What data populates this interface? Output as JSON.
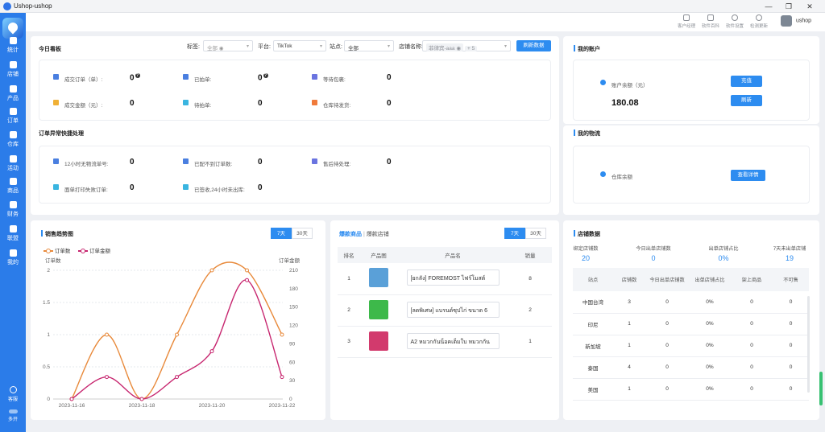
{
  "app": {
    "title": "Ushop-ushop"
  },
  "window": {
    "minimize": "—",
    "restore": "❐",
    "close": "✕"
  },
  "sidebar": {
    "items": [
      {
        "label": "统计",
        "icon": "bar-chart-icon"
      },
      {
        "label": "店铺",
        "icon": "store-icon"
      },
      {
        "label": "产品",
        "icon": "product-icon"
      },
      {
        "label": "订单",
        "icon": "order-icon"
      },
      {
        "label": "仓库",
        "icon": "warehouse-icon"
      },
      {
        "label": "活动",
        "icon": "gift-icon"
      },
      {
        "label": "商品",
        "icon": "goods-icon"
      },
      {
        "label": "财务",
        "icon": "finance-icon"
      },
      {
        "label": "联盟",
        "icon": "alliance-icon"
      },
      {
        "label": "我的",
        "icon": "user-icon"
      }
    ],
    "support_label": "客服",
    "multi_label": "多开"
  },
  "topbar": {
    "tools": [
      "客户经理",
      "软件百科",
      "软件设置",
      "检测更新"
    ],
    "username": "ushop"
  },
  "today": {
    "title": "今日看板",
    "filters": {
      "tag_label": "标签:",
      "tag_value": "全部",
      "platform_label": "平台:",
      "platform_value": "TikTok",
      "site_label": "站点:",
      "site_value": "全部",
      "shop_label": "店铺名称:",
      "shop_tag": "菲律宾-aaa",
      "shop_more": "+ 5"
    },
    "refresh_label": "刷新数据",
    "stats": [
      {
        "label": "成交订单（单）:",
        "value": "0",
        "q": true
      },
      {
        "label": "已拍单:",
        "value": "0",
        "q": true
      },
      {
        "label": "等待包裹:",
        "value": "0",
        "q": false
      },
      {
        "label": "成交金额（元）:",
        "value": "0",
        "q": false
      },
      {
        "label": "待拍单:",
        "value": "0",
        "q": false
      },
      {
        "label": "仓库待发货:",
        "value": "0",
        "q": false
      }
    ],
    "q_mark": "?"
  },
  "exceptions": {
    "title": "订单异常快捷处理",
    "stats": [
      {
        "label": "12小时无物流单号:",
        "value": "0"
      },
      {
        "label": "已配不到订单数:",
        "value": "0"
      },
      {
        "label": "售后待处理:",
        "value": "0"
      },
      {
        "label": "面单打印失败订单:",
        "value": "0"
      },
      {
        "label": "已签收,24小时未出库:",
        "value": "0"
      }
    ]
  },
  "account": {
    "title": "我的账户",
    "balance_label": "账户余额（元）",
    "balance_value": "180.08",
    "recharge_label": "充值",
    "refresh_label": "刷新"
  },
  "logistics": {
    "title": "我的物流",
    "warehouse_label": "仓库余额",
    "view_label": "查看详情"
  },
  "sales_trend": {
    "title": "销售趋势图",
    "tabs": [
      "7天",
      "30天"
    ],
    "active_tab": 0
  },
  "hot_products": {
    "title": "爆款商品",
    "title2": "爆款店铺",
    "tabs": [
      "7天",
      "30天"
    ],
    "active_tab": 0,
    "columns": [
      "排名",
      "产品图",
      "产品名",
      "销量"
    ],
    "rows": [
      {
        "rank": "1",
        "name": "[ยกลัง] FOREMOST ไฟร์โมสต์",
        "sales": "8",
        "color": "#5aa0d8"
      },
      {
        "rank": "2",
        "name": "[ลดพิเศษ] แบรนด์ซุปไก่ ขนาด 6",
        "sales": "2",
        "color": "#3db94a"
      },
      {
        "rank": "3",
        "name": "A2 หมวกกันน็อคเต็มใบ หมวกกัน",
        "sales": "1",
        "color": "#d23a6d"
      }
    ]
  },
  "shop_data": {
    "title": "店铺数据",
    "kpis": [
      {
        "label": "绑定店铺数",
        "value": "20"
      },
      {
        "label": "今日出单店铺数",
        "value": "0"
      },
      {
        "label": "出单店铺占比",
        "value": "0%"
      },
      {
        "label": "7天未出单店铺",
        "value": "19"
      }
    ],
    "columns": [
      "站点",
      "店铺数",
      "今日出单店铺数",
      "出单店铺占比",
      "架上商品",
      "不可售"
    ],
    "rows": [
      [
        "中国台湾",
        "3",
        "0",
        "0%",
        "0",
        "0"
      ],
      [
        "印尼",
        "1",
        "0",
        "0%",
        "0",
        "0"
      ],
      [
        "新加坡",
        "1",
        "0",
        "0%",
        "0",
        "0"
      ],
      [
        "泰国",
        "4",
        "0",
        "0%",
        "0",
        "0"
      ],
      [
        "美国",
        "1",
        "0",
        "0%",
        "0",
        "0"
      ]
    ]
  },
  "chart_data": {
    "type": "line",
    "legend": [
      "订单数",
      "订单金额"
    ],
    "ylabel_left": "订单数",
    "ylabel_right": "订单金额",
    "categories": [
      "2023-11-16",
      "2023-11-17",
      "2023-11-18",
      "2023-11-19",
      "2023-11-20",
      "2023-11-21",
      "2023-11-22"
    ],
    "x_tick_labels": [
      "2023-11-16",
      "2023-11-18",
      "2023-11-20",
      "2023-11-22"
    ],
    "y_left_ticks": [
      "0",
      "0.5",
      "1",
      "1.5",
      "2"
    ],
    "y_right_ticks": [
      "0",
      "30",
      "60",
      "90",
      "120",
      "150",
      "180",
      "210"
    ],
    "ylim_left": [
      0,
      2
    ],
    "ylim_right": [
      0,
      210
    ],
    "series": [
      {
        "name": "订单数",
        "axis": "left",
        "color": "#e8893a",
        "values": [
          0,
          1,
          0,
          1,
          2,
          2,
          1
        ]
      },
      {
        "name": "订单金额",
        "axis": "right",
        "color": "#c7266f",
        "values": [
          0,
          36,
          0,
          36,
          78,
          194,
          36
        ]
      }
    ]
  }
}
